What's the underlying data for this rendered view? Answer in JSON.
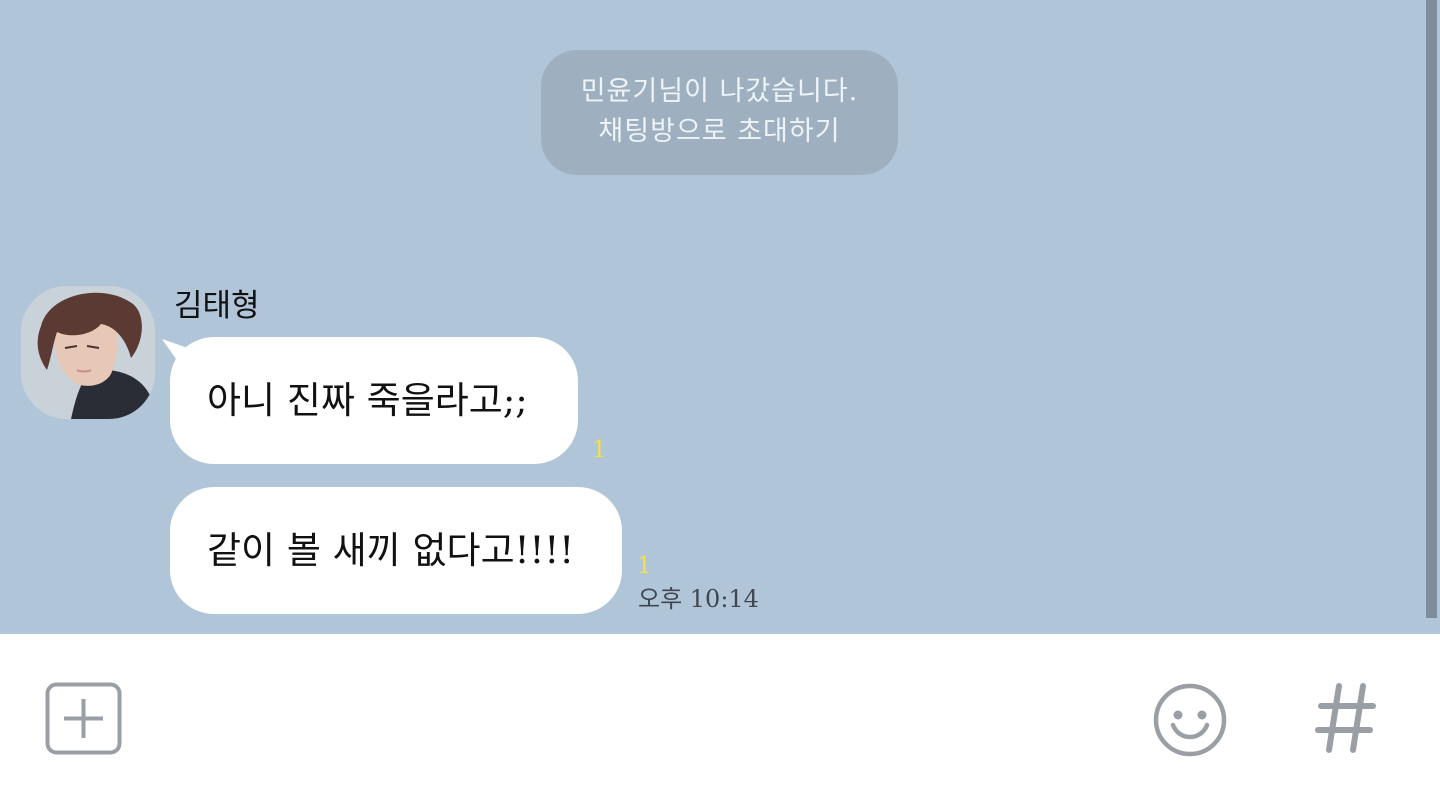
{
  "system_notice": {
    "left_message": "민윤기님이 나갔습니다.",
    "invite_link": "채팅방으로 초대하기"
  },
  "messages": [
    {
      "sender": "김태형",
      "text": "아니 진짜 죽을라고;;",
      "unread_count": "1"
    },
    {
      "text": "같이 볼 새끼 없다고!!!!",
      "unread_count": "1",
      "time": "오후 10:14"
    }
  ],
  "input_bar": {
    "plus_icon": "plus-square-icon",
    "emoji_icon": "smiley-icon",
    "hash_icon": "hashtag-icon"
  },
  "colors": {
    "chat_background": "#b1c5d9",
    "notice_background": "#9eb0c0",
    "bubble": "#ffffff",
    "unread_count": "#f2e24a",
    "icon_gray": "#9a9fa6"
  }
}
